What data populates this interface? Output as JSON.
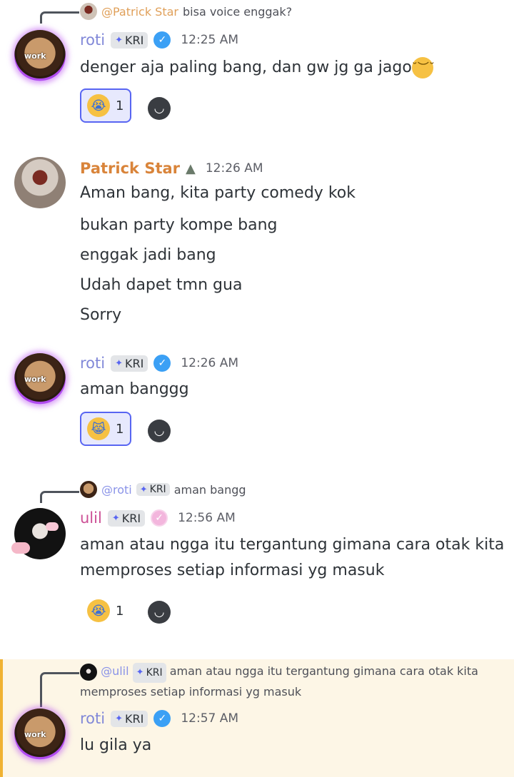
{
  "messages": [
    {
      "reply": {
        "mention": "@Patrick Star",
        "text": "bisa voice enggak?"
      },
      "author": "roti",
      "tag": "KRI",
      "time": "12:25 AM",
      "avatar_label": "work",
      "lines": [
        "denger aja paling bang, dan gw jg ga jago"
      ],
      "reaction": {
        "emoji": "😭",
        "count": "1"
      }
    },
    {
      "author": "Patrick Star",
      "time": "12:26 AM",
      "lines": [
        "Aman bang, kita party comedy kok",
        "bukan party kompe bang",
        "enggak jadi bang",
        "Udah dapet tmn gua",
        "Sorry"
      ]
    },
    {
      "author": "roti",
      "tag": "KRI",
      "time": "12:26 AM",
      "avatar_label": "work",
      "lines": [
        "aman banggg"
      ],
      "reaction": {
        "emoji": "😹",
        "count": "1"
      }
    },
    {
      "reply": {
        "mention": "@roti",
        "tag": "KRI",
        "text": "aman bangg"
      },
      "author": "ulil",
      "tag": "KRI",
      "time": "12:56 AM",
      "lines": [
        "aman atau ngga itu tergantung gimana cara otak kita",
        "memproses setiap informasi yg masuk"
      ],
      "reaction": {
        "emoji": "😭",
        "count": "1"
      }
    },
    {
      "reply": {
        "mention": "@ulil",
        "tag": "KRI",
        "text": "aman atau ngga itu tergantung gimana cara otak kita",
        "text2": "memproses setiap informasi yg masuk"
      },
      "author": "roti",
      "tag": "KRI",
      "time": "12:57 AM",
      "avatar_label": "work",
      "lines": [
        "lu gila ya"
      ]
    }
  ],
  "icons": {
    "verified": "check-badge",
    "add_reaction": "smile-face",
    "role_tag": "diamond-icon"
  },
  "colors": {
    "roti": "#8188d8",
    "patrick": "#d9843a",
    "ulil": "#cc4f95",
    "highlight_bar": "#f0b232",
    "highlight_bg": "#fdf6e6",
    "reaction_active": "#5865f2"
  }
}
